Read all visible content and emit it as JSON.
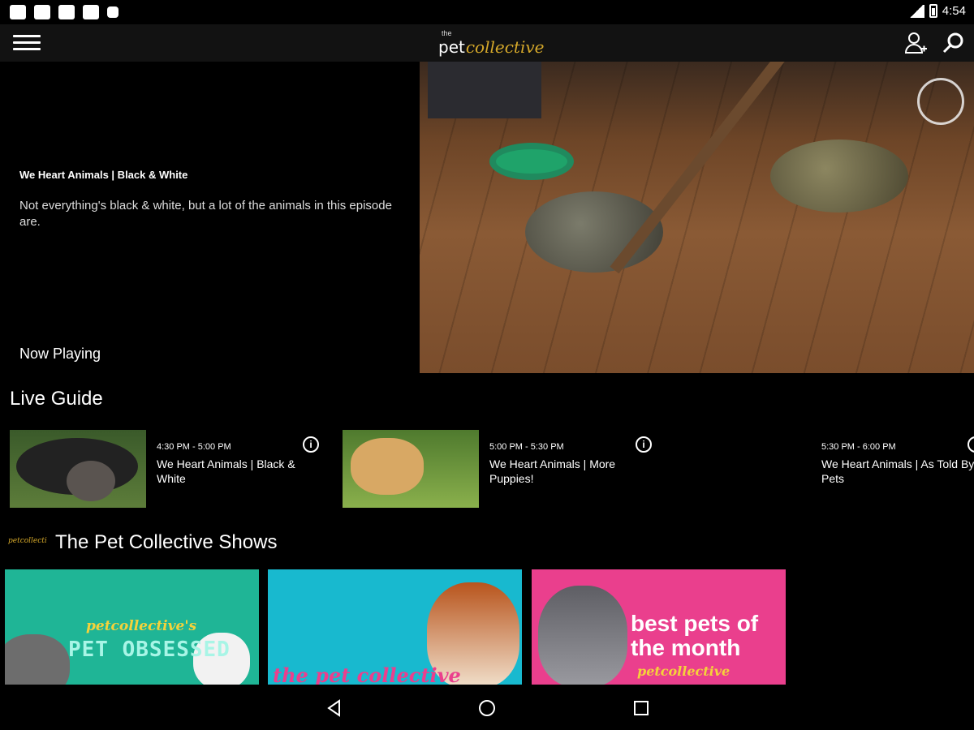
{
  "status_bar": {
    "time": "4:54"
  },
  "app_bar": {
    "logo_the": "the",
    "logo_pet": "pet",
    "logo_collective": "collective"
  },
  "now_playing": {
    "title": "We Heart Animals | Black & White",
    "description": "Not everything's black & white, but a lot of the animals in this episode are.",
    "label": "Now Playing"
  },
  "live_guide": {
    "title": "Live Guide",
    "items": [
      {
        "time": "4:30 PM - 5:00 PM",
        "name": "We Heart Animals | Black & White"
      },
      {
        "time": "5:00 PM - 5:30 PM",
        "name": "We Heart Animals | More Puppies!"
      },
      {
        "time": "5:30 PM - 6:00 PM",
        "name": "We Heart Animals | As Told By Pets"
      }
    ]
  },
  "shows": {
    "logo_text": "petcollective",
    "title": "The Pet Collective Shows",
    "cards": [
      {
        "logo_line": "petcollective's",
        "name": "PET OBSESSED"
      },
      {
        "logo_line": "the pet collective",
        "name": ""
      },
      {
        "logo_line": "petcollective",
        "name": "best pets of the month"
      }
    ]
  },
  "colors": {
    "gold": "#d6a92a",
    "teal": "#1fb596",
    "cyan": "#18b9cf",
    "pink": "#ea3f8d"
  }
}
